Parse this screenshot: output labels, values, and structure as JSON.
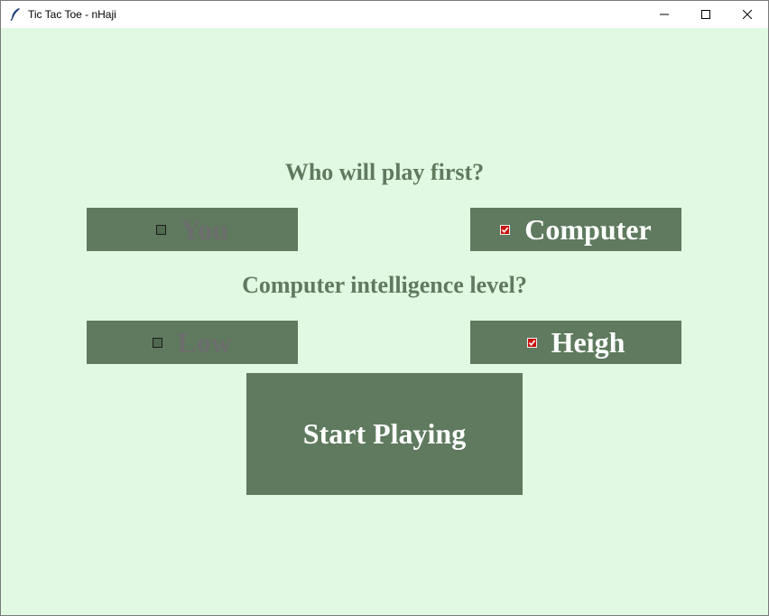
{
  "window": {
    "title": "Tic Tac Toe - nHaji",
    "icon": "feather-icon",
    "controls": [
      "minimize-icon",
      "maximize-icon",
      "close-icon"
    ]
  },
  "first_player": {
    "question": "Who will play first?",
    "options": [
      {
        "label": "You",
        "checked": false
      },
      {
        "label": "Computer",
        "checked": true
      }
    ]
  },
  "intelligence": {
    "question": "Computer intelligence level?",
    "options": [
      {
        "label": "Low",
        "checked": false
      },
      {
        "label": "Heigh",
        "checked": true
      }
    ]
  },
  "start_button": {
    "label": "Start Playing"
  },
  "colors": {
    "background": "#e1f9e3",
    "panel": "#5f7a5f",
    "question_text": "#5f7a5f",
    "selected_text": "#ffffff",
    "unselected_text": "#6d6d6d",
    "checkbox_checked": "#c9140f"
  }
}
